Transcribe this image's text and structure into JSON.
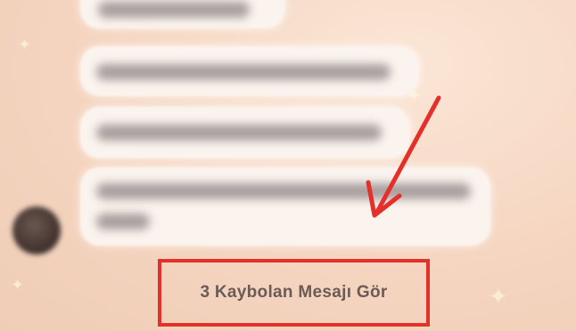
{
  "chat": {
    "disappeared_messages_label": "3 Kaybolan Mesajı Gör"
  },
  "colors": {
    "annotation_red": "#e4302b",
    "bubble_bg": "#fbf3ee",
    "label_text": "#6b5a55"
  },
  "icons": {
    "avatar": "user-avatar",
    "arrow": "annotation-arrow-icon"
  }
}
